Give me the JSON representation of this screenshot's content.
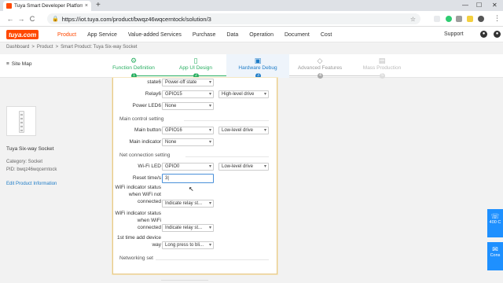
{
  "browser": {
    "tab_title": "Tuya Smart Developer Platform",
    "tab_close": "×",
    "new_tab": "+",
    "back": "←",
    "forward": "→",
    "reload": "C",
    "lock": "🔒",
    "url_host": "https://iot.tuya.com",
    "url_path": "/product/bwqz46wqcerntock/solution/3",
    "star": "☆",
    "menu": "⋮",
    "min": "—",
    "max": "☐",
    "close": "✕"
  },
  "site": {
    "logo": "tuya.com",
    "nav": [
      "Product",
      "App Service",
      "Value-added Services",
      "Purchase",
      "Data",
      "Operation",
      "Document",
      "Cost"
    ],
    "support": "Support",
    "brand_color": "#ff4800"
  },
  "breadcrumb": [
    "Dashboard",
    ">",
    "Product",
    ">",
    "Smart Product: Tuya Six-way Socket"
  ],
  "sitemap": {
    "icon": "≡",
    "label": "Site Map"
  },
  "steps": [
    {
      "icon": "⚙",
      "label": "Function Definition",
      "num": "1",
      "state": "done"
    },
    {
      "icon": "▯",
      "label": "App UI Design",
      "num": "2",
      "state": "done"
    },
    {
      "icon": "▣",
      "label": "Hardware Debug",
      "num": "3",
      "state": "active"
    },
    {
      "icon": "◇",
      "label": "Advanced Features",
      "num": "4",
      "state": "todo"
    },
    {
      "icon": "▤",
      "label": "Mass Production",
      "num": "5",
      "state": "todo"
    }
  ],
  "product": {
    "name": "Tuya Six-way Socket",
    "category": "Category: Socket",
    "pid": "PID: bwqz46wqcerntock",
    "edit_link": "Edit Product Information"
  },
  "form": {
    "state6_label": "state6",
    "state6_value": "Power-off state",
    "relay6_label": "Relay6",
    "relay6_value": "GPIO15",
    "relay6_drive": "High-level drive",
    "powerled6_label": "Power LED6",
    "powerled6_value": "None",
    "main_control_title": "Main control setting",
    "main_button_label": "Main button",
    "main_button_value": "GPIO16",
    "main_button_drive": "Low-level drive",
    "main_indicator_label": "Main indicator",
    "main_indicator_value": "None",
    "net_title": "Net connection setting",
    "wifi_led_label": "Wi-Fi LED",
    "wifi_led_value": "GPIO0",
    "wifi_led_drive": "Low-level drive",
    "reset_label": "Reset time/s",
    "reset_value": "3|",
    "wifi_not_connected_label_1": "WiFi indicator status",
    "wifi_not_connected_label_2": "when WiFi not",
    "wifi_not_connected_label_3": "connected",
    "wifi_not_connected_value": "Indicate relay st...",
    "wifi_connected_label_1": "WiFi indicator status",
    "wifi_connected_label_2": "when WiFi",
    "wifi_connected_label_3": "connected",
    "wifi_connected_value": "Indicate relay st...",
    "first_add_label_1": "1st time add device",
    "first_add_label_2": "way",
    "first_add_value": "Long press to bli...",
    "networking_title": "Networking set"
  },
  "float": [
    {
      "icon": "☏",
      "label": "400 C"
    },
    {
      "icon": "✉",
      "label": "Cons"
    }
  ]
}
